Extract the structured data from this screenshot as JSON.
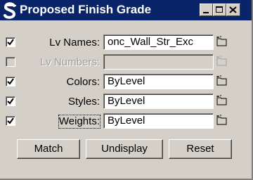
{
  "window": {
    "title": "Proposed Finish Grade",
    "app_icon": "script-s-icon",
    "controls": [
      "minimize-icon",
      "maximize-icon",
      "close-icon"
    ]
  },
  "rows": [
    {
      "label": "Lv Names:",
      "value": "onc_Wall_Str_Exc",
      "checked": true,
      "enabled": true
    },
    {
      "label": "Lv Numbers:",
      "value": "",
      "checked": false,
      "enabled": false
    },
    {
      "label": "Colors:",
      "value": "ByLevel",
      "checked": true,
      "enabled": true
    },
    {
      "label": "Styles:",
      "value": "ByLevel",
      "checked": true,
      "enabled": true
    },
    {
      "label": "Weights:",
      "value": "ByLevel",
      "checked": true,
      "enabled": true,
      "focused": true
    }
  ],
  "field_icon": "folder-icon",
  "buttons": {
    "match": "Match",
    "undisplay": "Undisplay",
    "reset": "Reset"
  },
  "colors": {
    "titlebar": "#0a246a",
    "face": "#d4d0c8",
    "disabled_text": "#a0a0a0"
  }
}
